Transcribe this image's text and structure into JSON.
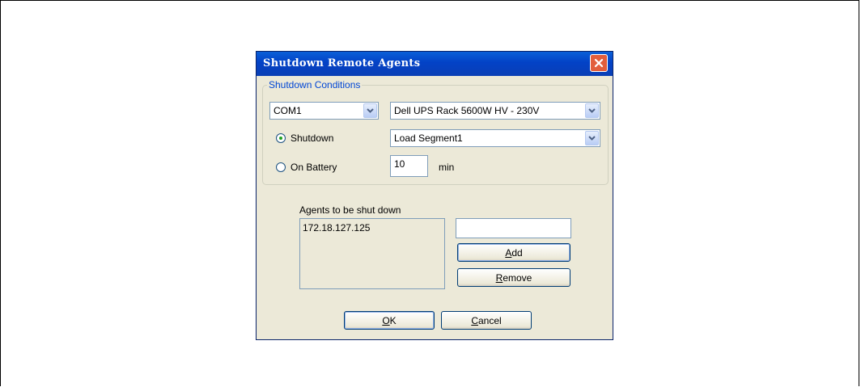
{
  "dialog": {
    "title": "Shutdown Remote Agents"
  },
  "conditions": {
    "legend": "Shutdown Conditions",
    "port_value": "COM1",
    "ups_value": "Dell UPS Rack 5600W HV - 230V",
    "shutdown_label": "Shutdown",
    "shutdown_selected": true,
    "segment_value": "Load Segment1",
    "on_battery_label": "On Battery",
    "on_battery_selected": false,
    "minutes_value": "10",
    "minutes_unit": "min"
  },
  "agents": {
    "label": "Agents to be shut down",
    "items": [
      "172.18.127.125"
    ],
    "new_agent_value": "",
    "add_label_mnemonic": "A",
    "add_label_rest": "dd",
    "remove_label_mnemonic": "R",
    "remove_label_rest": "emove"
  },
  "footer": {
    "ok_label_mnemonic": "O",
    "ok_label_rest": "K",
    "cancel_label_mnemonic": "C",
    "cancel_label_rest": "ancel"
  },
  "colors": {
    "titlebar": "#0342c6",
    "legend": "#0046d5",
    "close": "#e25e3c",
    "radio_dot": "#21a121"
  },
  "icons": {
    "close": "close-icon",
    "dropdown": "chevron-down-icon"
  }
}
